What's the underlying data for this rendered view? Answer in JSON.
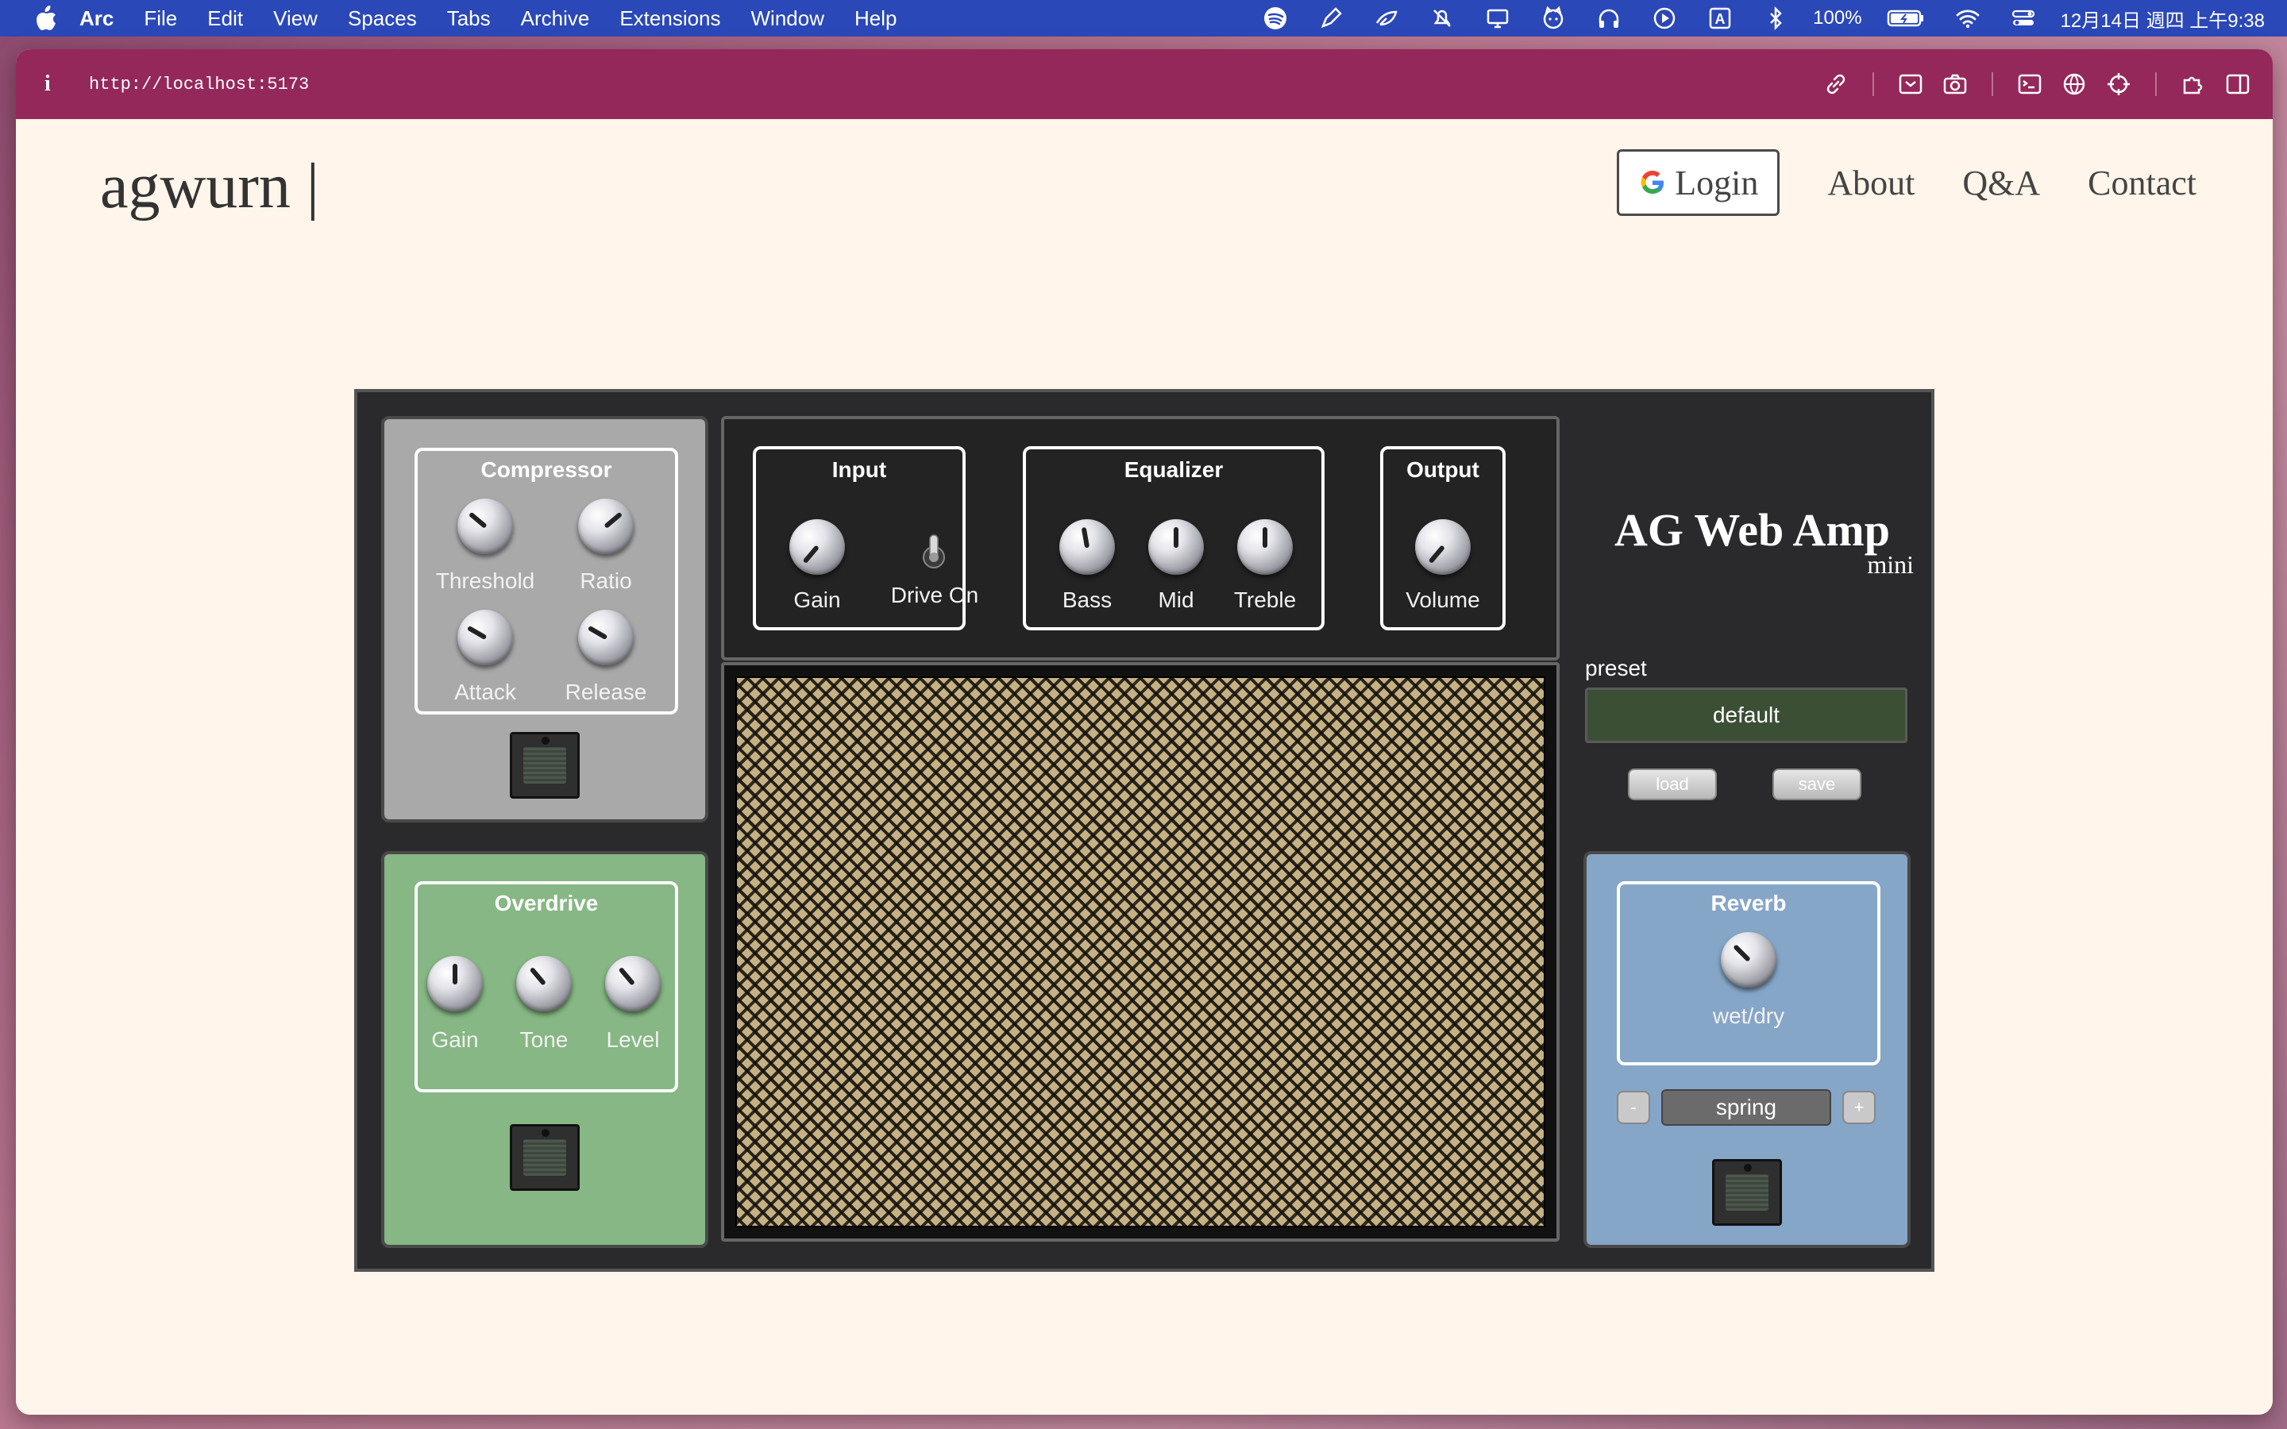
{
  "menubar": {
    "app": "Arc",
    "items": [
      "File",
      "Edit",
      "View",
      "Spaces",
      "Tabs",
      "Archive",
      "Extensions",
      "Window",
      "Help"
    ],
    "battery": "100%",
    "datetime": "12月14日 週四 上午9:38",
    "icons": [
      "spotify-icon",
      "pen-icon",
      "feather-icon",
      "bell-slash-icon",
      "display-icon",
      "cat-icon",
      "headphones-icon",
      "play-icon",
      "input-source-icon",
      "bluetooth-icon",
      "battery-icon",
      "wifi-icon",
      "control-center-icon"
    ]
  },
  "browser": {
    "url": "http://localhost:5173",
    "info_glyph": "i"
  },
  "site": {
    "logo": "agwurn |",
    "nav": {
      "login": "Login",
      "about": "About",
      "qa": "Q&A",
      "contact": "Contact"
    }
  },
  "amp": {
    "brand": "AG Web Amp",
    "brand_sub": "mini",
    "compressor": {
      "title": "Compressor",
      "knobs": {
        "threshold": "Threshold",
        "ratio": "Ratio",
        "attack": "Attack",
        "release": "Release"
      }
    },
    "overdrive": {
      "title": "Overdrive",
      "knobs": {
        "gain": "Gain",
        "tone": "Tone",
        "level": "Level"
      }
    },
    "input": {
      "title": "Input",
      "gain": "Gain",
      "drive": "Drive On"
    },
    "equalizer": {
      "title": "Equalizer",
      "bass": "Bass",
      "mid": "Mid",
      "treble": "Treble"
    },
    "output": {
      "title": "Output",
      "volume": "Volume"
    },
    "preset": {
      "label": "preset",
      "value": "default",
      "load": "load",
      "save": "save"
    },
    "reverb": {
      "title": "Reverb",
      "knob": "wet/dry",
      "type": "spring",
      "minus": "-",
      "plus": "+"
    },
    "colors": {
      "compressor_bg": "#a9a9aa",
      "overdrive_bg": "#86b784",
      "reverb_bg": "#86a6c8",
      "preset_bg": "#3b4f34"
    }
  }
}
